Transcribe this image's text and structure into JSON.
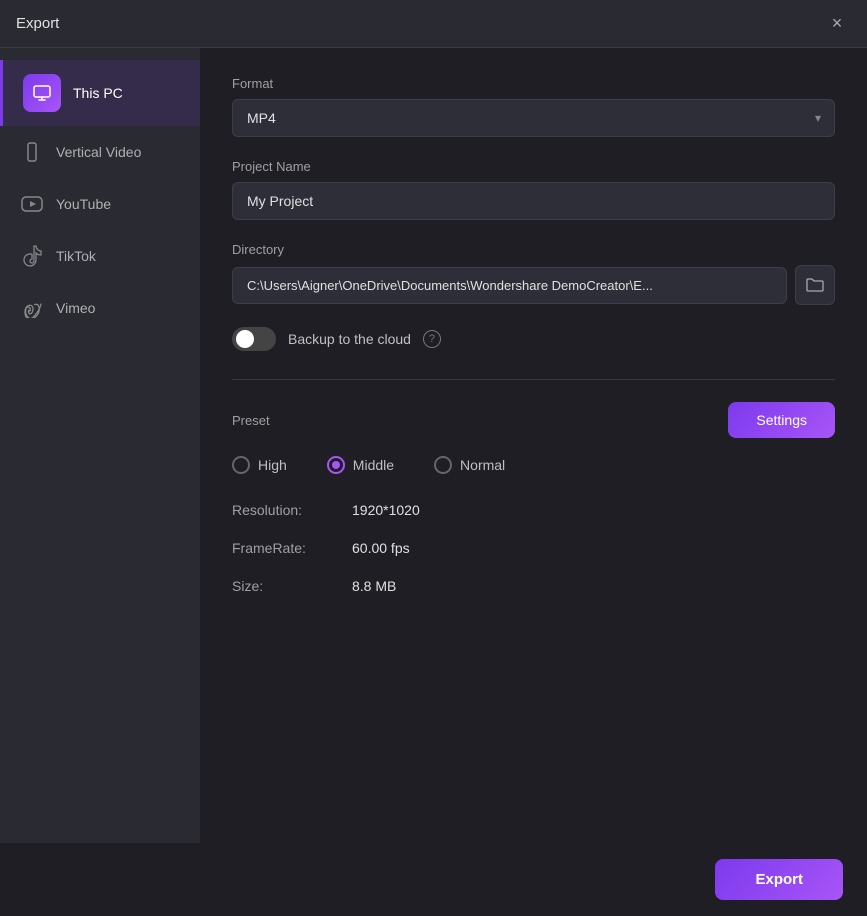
{
  "titleBar": {
    "title": "Export",
    "closeLabel": "×"
  },
  "sidebar": {
    "items": [
      {
        "id": "this-pc",
        "label": "This PC",
        "active": true
      },
      {
        "id": "vertical-video",
        "label": "Vertical Video",
        "active": false
      },
      {
        "id": "youtube",
        "label": "YouTube",
        "active": false
      },
      {
        "id": "tiktok",
        "label": "TikTok",
        "active": false
      },
      {
        "id": "vimeo",
        "label": "Vimeo",
        "active": false
      }
    ]
  },
  "content": {
    "formatLabel": "Format",
    "formatValue": "MP4",
    "projectNameLabel": "Project Name",
    "projectNameValue": "My Project",
    "directoryLabel": "Directory",
    "directoryValue": "C:\\Users\\Aigner\\OneDrive\\Documents\\Wondershare DemoCreator\\E...",
    "backupLabel": "Backup to the cloud",
    "backupEnabled": false,
    "presetLabel": "Preset",
    "settingsLabel": "Settings",
    "presets": [
      {
        "id": "high",
        "label": "High",
        "checked": false
      },
      {
        "id": "middle",
        "label": "Middle",
        "checked": true
      },
      {
        "id": "normal",
        "label": "Normal",
        "checked": false
      }
    ],
    "resolutionLabel": "Resolution:",
    "resolutionValue": "1920*1020",
    "frameRateLabel": "FrameRate:",
    "frameRateValue": "60.00 fps",
    "sizeLabel": "Size:",
    "sizeValue": "8.8 MB"
  },
  "footer": {
    "exportLabel": "Export"
  }
}
